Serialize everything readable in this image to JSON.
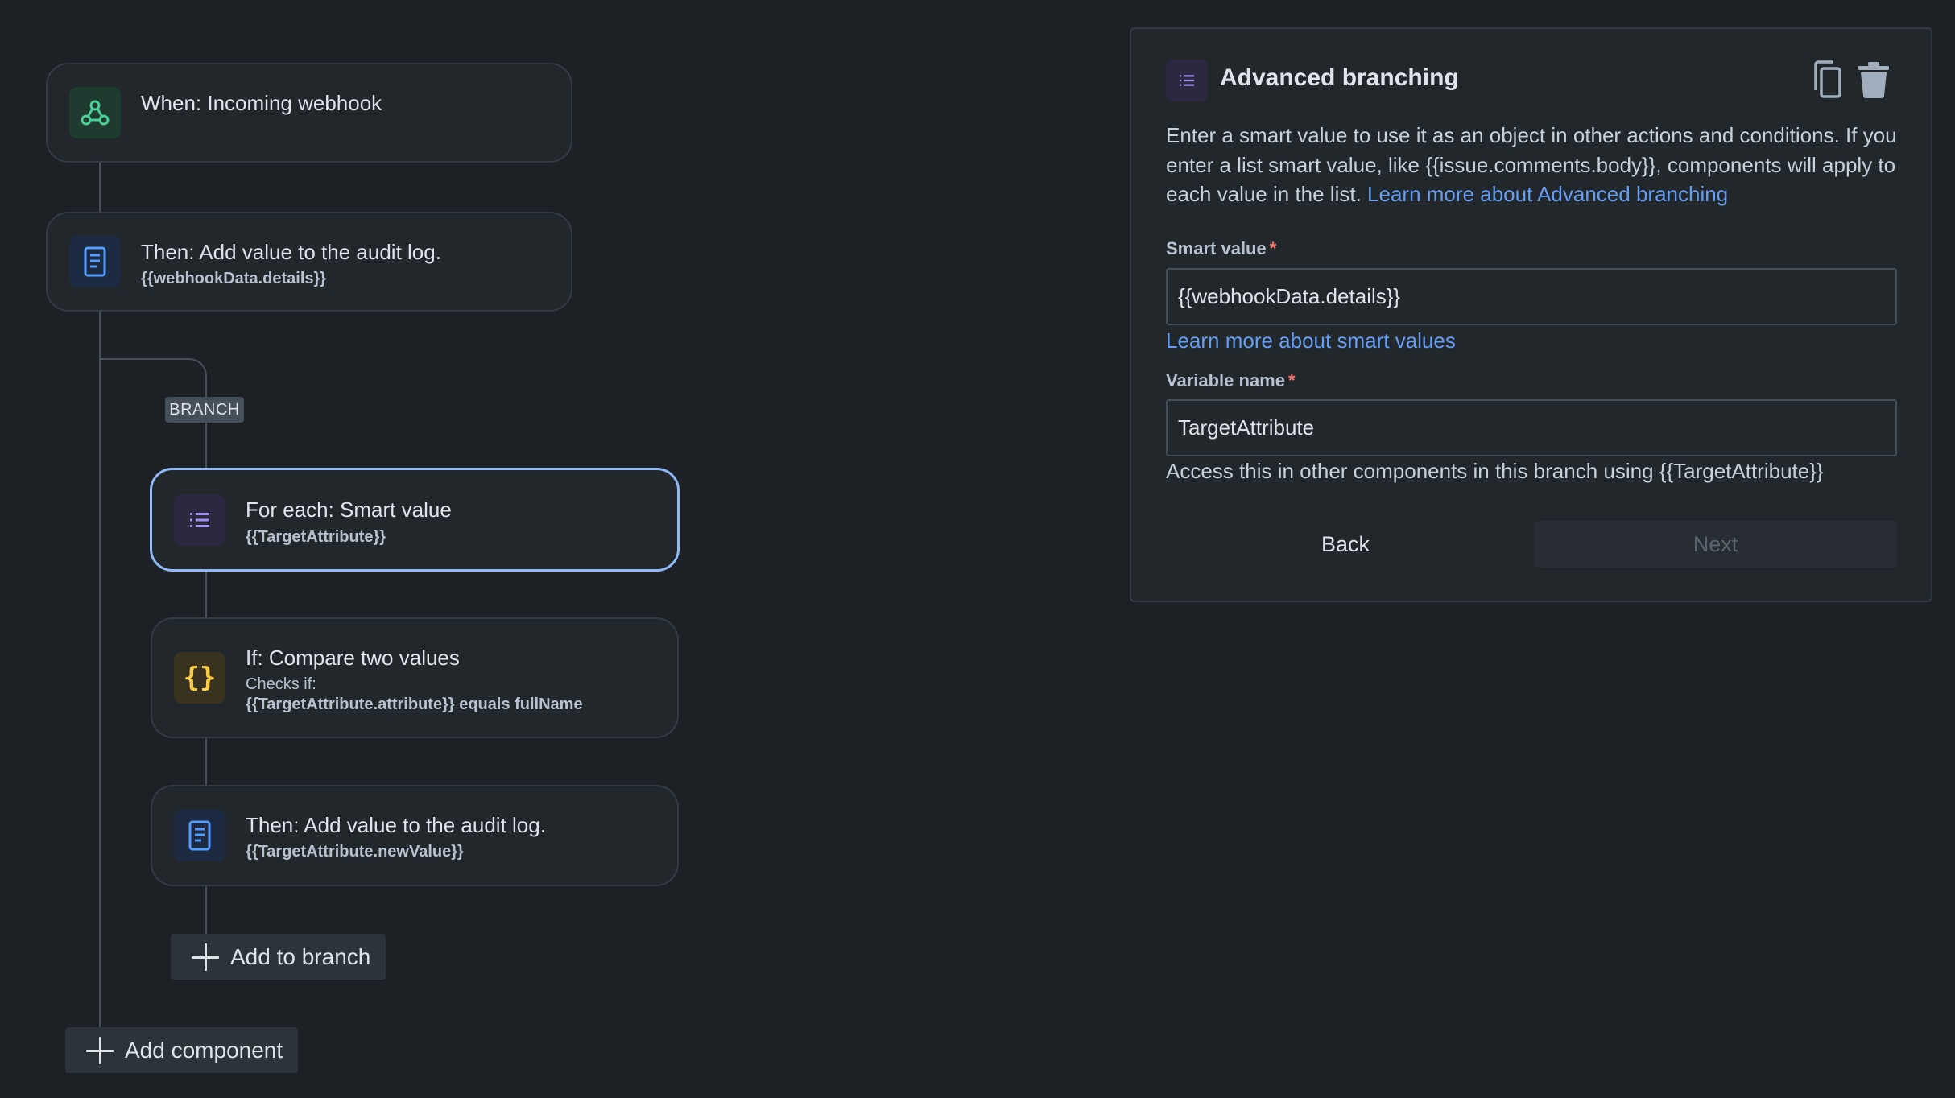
{
  "colors": {
    "background": "#1d2125",
    "card": "#22272b",
    "selected_border": "#8fb8f6",
    "link": "#669df1",
    "required": "#f87168",
    "webhook_icon": "#4bce97",
    "log_icon": "#579dff",
    "branch_icon": "#9f8fef",
    "condition_icon": "#f5cd47"
  },
  "flow": {
    "trigger": {
      "title": "When: Incoming webhook",
      "icon": "webhook-icon"
    },
    "action1": {
      "title": "Then: Add value to the audit log.",
      "sub": "{{webhookData.details}}",
      "icon": "audit-log-icon"
    },
    "branch_label": "BRANCH",
    "foreach": {
      "title": "For each: Smart value",
      "sub": "{{TargetAttribute}}",
      "icon": "list-icon"
    },
    "condition": {
      "title": "If: Compare two values",
      "sub_label": "Checks if:",
      "sub": "{{TargetAttribute.attribute}} equals fullName",
      "icon": "braces-icon"
    },
    "action2": {
      "title": "Then: Add value to the audit log.",
      "sub": "{{TargetAttribute.newValue}}",
      "icon": "audit-log-icon"
    },
    "add_to_branch": "Add to branch",
    "add_component": "Add component"
  },
  "panel": {
    "title": "Advanced branching",
    "description": "Enter a smart value to use it as an object in other actions and conditions. If you enter a list smart value, like {{issue.comments.body}}, components will apply to each value in the list.",
    "description_link": "Learn more about Advanced branching",
    "smart_value_label": "Smart value",
    "smart_value": "{{webhookData.details}}",
    "smart_value_link": "Learn more about smart values",
    "variable_name_label": "Variable name",
    "variable_name": "TargetAttribute",
    "variable_help": "Access this in other components in this branch using {{TargetAttribute}}",
    "required_marker": "*",
    "back_label": "Back",
    "next_label": "Next",
    "copy_icon": "copy-icon",
    "delete_icon": "trash-icon"
  }
}
